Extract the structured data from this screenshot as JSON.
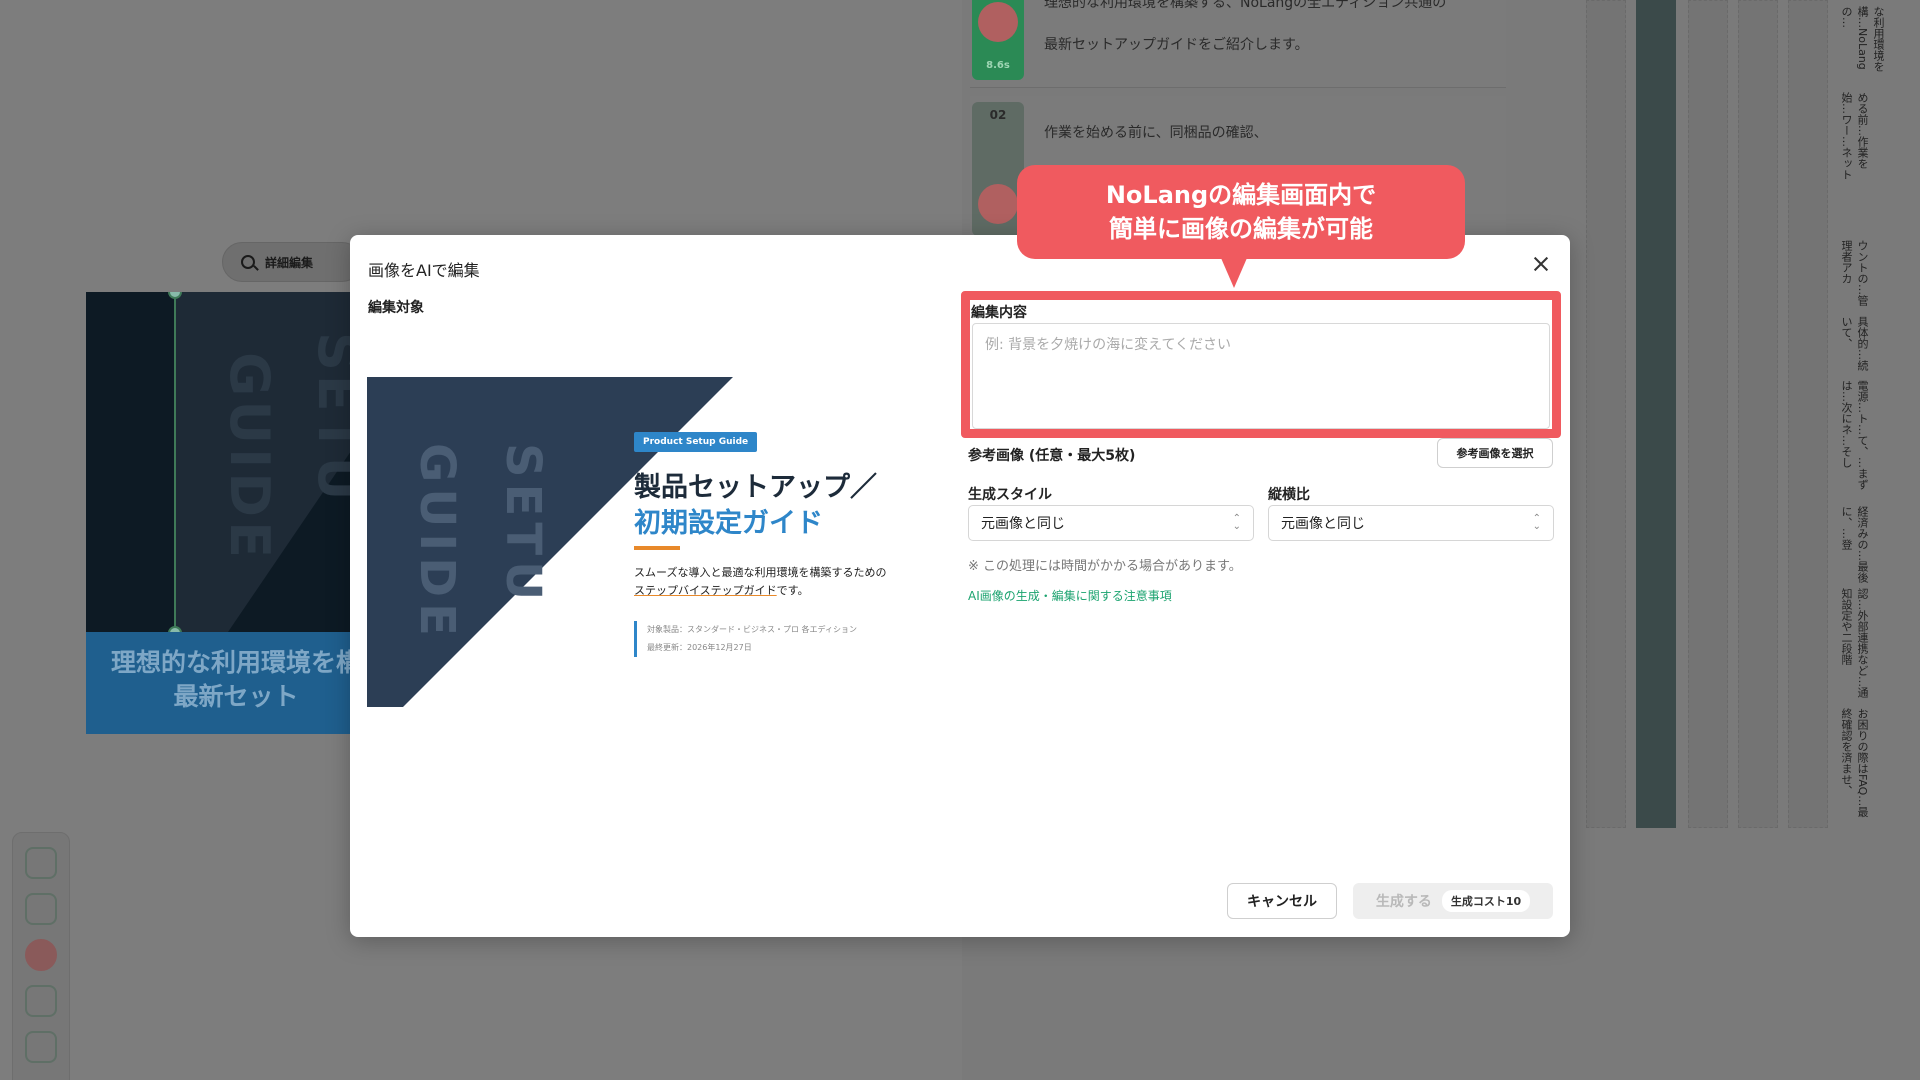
{
  "background": {
    "zoom_button_label": "詳細編集",
    "slide_caption_line1": "理想的な利用環境を構",
    "slide_caption_line2": "最新セット",
    "slide_ghost_text_1": "SETU",
    "slide_ghost_text_2": "GUIDE",
    "scenes": [
      {
        "number": "",
        "duration": "8.6s",
        "line1": "理想的な利用環境を構築する、NoLangの全エディション共通の",
        "line2": "最新セットアップガイドをご紹介します。"
      },
      {
        "number": "02",
        "line1": "作業を始める前に、同梱品の確認、"
      }
    ],
    "side_texts": [
      "な利用環境を構…NoLangの…",
      "める前…作業を始…ワー…ネット",
      "ウントの…管理者アカ",
      "具体的…続いて、",
      "電源…ト…て、…まずは…次にネ…そし",
      "経済みの…最後に、…登",
      "認…外部連携など…通知設定や二段階",
      "お困りの際はFAQ…最終確認を済ませ、"
    ]
  },
  "dialog": {
    "title": "画像をAIで編集",
    "target_label": "編集対象",
    "preview": {
      "tag": "Product Setup Guide",
      "heading_line1": "製品セットアップ／",
      "heading_line2": "初期設定ガイド",
      "desc_line1": "スムーズな導入と最適な利用環境を構築するための",
      "desc_line2_underlined": "ステップバイステップガイド",
      "desc_line2_rest": "です。",
      "meta_line1": "対象製品：スタンダード・ビジネス・プロ 各エディション",
      "meta_line2": "最終更新：2026年12月27日",
      "ghost_text_1": "SETU",
      "ghost_text_2": "GUIDE"
    },
    "edit_label": "編集内容",
    "edit_placeholder": "例: 背景を夕焼けの海に変えてください",
    "edit_value": "",
    "reference_label": "参考画像 (任意・最大5枚)",
    "reference_button": "参考画像を選択",
    "style_label": "生成スタイル",
    "style_value": "元画像と同じ",
    "aspect_label": "縦横比",
    "aspect_value": "元画像と同じ",
    "note": "※ この処理には時間がかかる場合があります。",
    "caution_link": "AI画像の生成・編集に関する注意事項",
    "cancel_button": "キャンセル",
    "generate_button": "生成する",
    "generate_cost": "生成コスト10"
  },
  "callout": {
    "line1": "NoLangの編集画面内で",
    "line2": "簡単に画像の編集が可能"
  },
  "colors": {
    "highlight": "#f05a5f",
    "accent_blue": "#2e86c9",
    "accent_orange": "#e8892a",
    "link_green": "#1ba36f"
  }
}
